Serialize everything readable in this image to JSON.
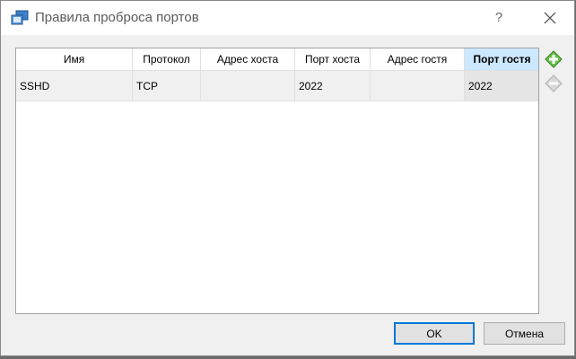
{
  "window": {
    "title": "Правила проброса портов",
    "help_label": "?"
  },
  "table": {
    "columns": [
      "Имя",
      "Протокол",
      "Адрес хоста",
      "Порт хоста",
      "Адрес гостя",
      "Порт гостя"
    ],
    "sorted_column": "Порт гостя",
    "rows": [
      {
        "name": "SSHD",
        "protocol": "TCP",
        "host_ip": "",
        "host_port": "2022",
        "guest_ip": "",
        "guest_port": "2022"
      }
    ]
  },
  "side_toolbar": {
    "add_icon": "add-rule-icon",
    "remove_icon": "remove-rule-icon"
  },
  "buttons": {
    "ok": "OK",
    "cancel": "Отмена"
  },
  "colors": {
    "accent": "#0078d7",
    "sorted_header": "#cce8ff"
  }
}
